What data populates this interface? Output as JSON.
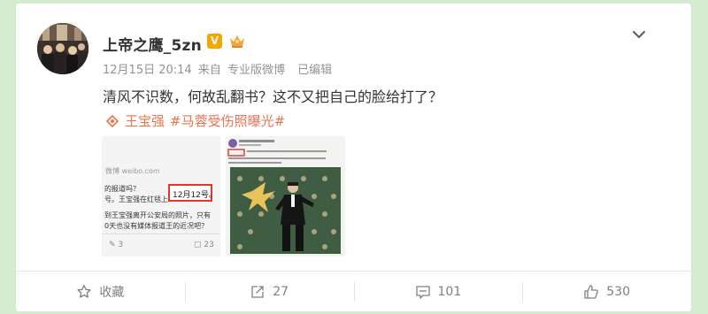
{
  "post": {
    "author": "上帝之鹰_5zn",
    "verified_badge": "V",
    "meta": {
      "date": "12月15日 20:14",
      "source_prefix": "来自",
      "source": "专业版微博",
      "edited": "已编辑"
    },
    "text": "清风不识数，何故乱翻书？这不又把自己的脸给打了？",
    "hashtags": [
      "王宝强",
      "#马蓉受伤照曝光#"
    ],
    "images": [
      {
        "watermark": "微博 weibo.com",
        "lines": [
          "的报道吗？",
          "号。王宝强在红毯上",
          "到王宝强离开公安局的照片，只有",
          "0天也没有媒体报道王的近况吧？"
        ],
        "highlight": "12月12号。",
        "comment_count": "3",
        "like_count": "23"
      },
      {
        "caption_lines": [
          "12月12日，在红毯上的王宝强现身颁奖典礼",
          "王宝强身穿黑色西装，笑容满面"
        ]
      }
    ]
  },
  "footer": {
    "favorite_label": "收藏",
    "repost_count": "27",
    "comment_count": "101",
    "like_count": "530"
  },
  "colors": {
    "accent": "#eb7350",
    "background": "#d6ecd1",
    "badge": "#f7a600",
    "highlight_box": "#e0362b"
  },
  "icons": [
    "chevron-down-icon",
    "verified-v-icon",
    "member-crown-icon",
    "topic-icon",
    "star-icon",
    "repost-icon",
    "comment-icon",
    "like-icon"
  ]
}
